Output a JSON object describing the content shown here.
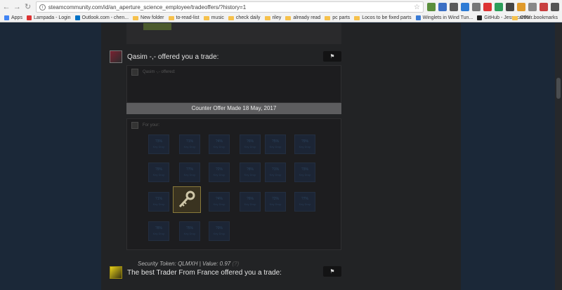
{
  "browser": {
    "url": "steamcommunity.com/id/an_aperture_science_employee/tradeoffers/?history=1",
    "bookmarks": [
      {
        "label": "Apps",
        "kind": "apps"
      },
      {
        "label": "Lampada - Login",
        "kind": "fav",
        "color": "#d33"
      },
      {
        "label": "Outlook.com - chen...",
        "kind": "fav",
        "color": "#0072c6"
      },
      {
        "label": "New folder",
        "kind": "folder"
      },
      {
        "label": "to-read-list",
        "kind": "folder"
      },
      {
        "label": "music",
        "kind": "folder"
      },
      {
        "label": "check daily",
        "kind": "folder"
      },
      {
        "label": "riley",
        "kind": "folder"
      },
      {
        "label": "already read",
        "kind": "folder"
      },
      {
        "label": "pc parts",
        "kind": "folder"
      },
      {
        "label": "Locos to be fixed parts",
        "kind": "folder"
      },
      {
        "label": "Winglets in Wind Tun...",
        "kind": "fav",
        "color": "#3a7bd5"
      },
      {
        "label": "GitHub - Jessecar96/...",
        "kind": "fav",
        "color": "#222"
      }
    ],
    "other_bookmarks": "Other bookmarks"
  },
  "offers": [
    {
      "title": "Qasim -,- offered you a trade:",
      "their_label": "Qasim -,- offered:",
      "counter_text": "Counter Offer Made 18 May, 2017",
      "your_label": "For your:",
      "your_items": [
        [
          "?3%",
          "Key Drop"
        ],
        [
          "?1%",
          "Key Drop"
        ],
        [
          "?4%",
          "Key Drop"
        ],
        [
          "?6%",
          "Key Drop"
        ],
        [
          "?5%",
          "Key Drop"
        ],
        [
          "?9%",
          "Key Drop"
        ],
        [
          "?9%",
          "Key Drop"
        ],
        [
          "?7%",
          "Key Drop"
        ],
        [
          "?2%",
          "Key Drop"
        ],
        [
          "?8%",
          "Key Drop"
        ],
        [
          "?1%",
          "Key Drop"
        ],
        [
          "?3%",
          "Key Drop"
        ],
        [
          "?1%",
          "Key Drop"
        ],
        [
          "?4%",
          "Key Drop"
        ],
        [
          "?6%",
          "Key Drop"
        ],
        [
          "?2%",
          "Key Drop"
        ],
        [
          "?7%",
          "Key Drop"
        ],
        [
          "?8%",
          "Key Drop"
        ],
        [
          "?5%",
          "Key Drop"
        ],
        [
          "?9%",
          "Key Drop"
        ]
      ]
    },
    {
      "title": "The best Trader From France offered you a trade:",
      "security_token": "Security Token: QLMXH | Value: 0.97",
      "security_tail": "(?)"
    }
  ],
  "icons": {
    "flag": "flag-icon",
    "key": "key-icon"
  }
}
